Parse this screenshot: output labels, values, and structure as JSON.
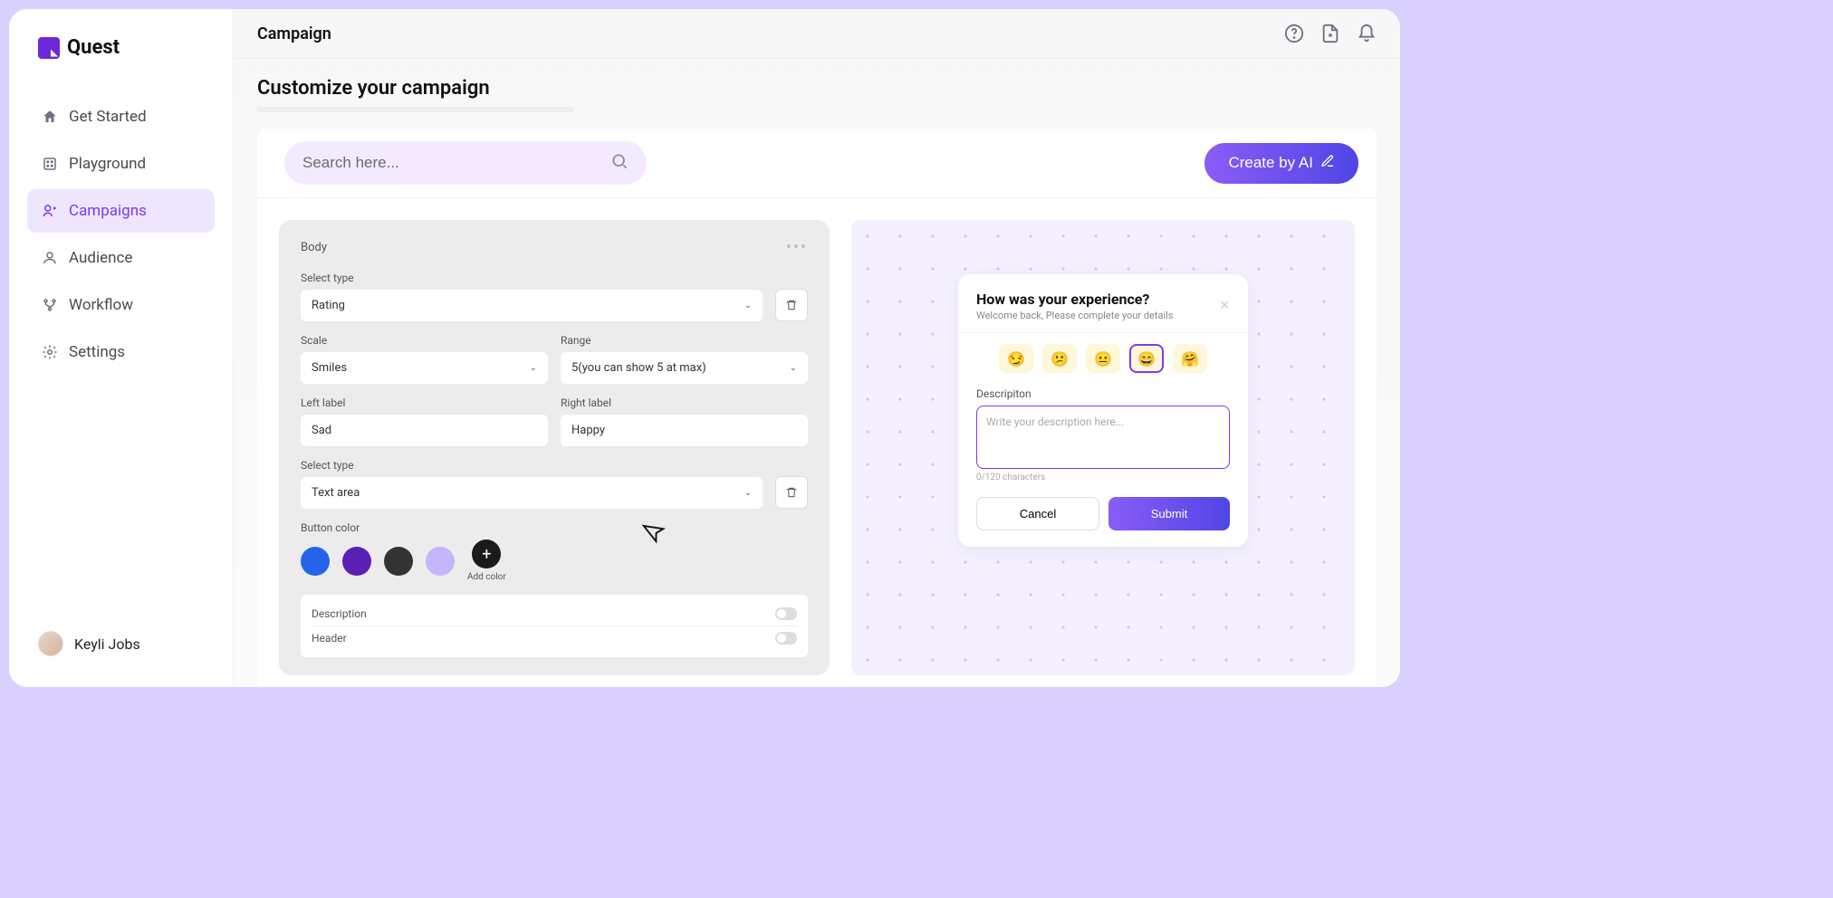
{
  "brand": "Quest",
  "user": {
    "name": "Keyli Jobs"
  },
  "sidebar": {
    "items": [
      {
        "label": "Get Started",
        "icon": "home"
      },
      {
        "label": "Playground",
        "icon": "grid"
      },
      {
        "label": "Campaigns",
        "icon": "user-plus"
      },
      {
        "label": "Audience",
        "icon": "user"
      },
      {
        "label": "Workflow",
        "icon": "branch"
      },
      {
        "label": "Settings",
        "icon": "gear"
      }
    ]
  },
  "header": {
    "title": "Campaign"
  },
  "page": {
    "title": "Customize your campaign",
    "search_placeholder": "Search here...",
    "create_label": "Create by AI"
  },
  "builder": {
    "section_title": "Body",
    "type1_label": "Select type",
    "type1_value": "Rating",
    "scale_label": "Scale",
    "scale_value": "Smiles",
    "range_label": "Range",
    "range_value": "5(you can show 5 at max)",
    "left_label": "Left label",
    "left_value": "Sad",
    "right_label": "Right label",
    "right_value": "Happy",
    "type2_label": "Select type",
    "type2_value": "Text area",
    "button_color_label": "Button color",
    "colors": [
      "#2563eb",
      "#5b21b6",
      "#333333",
      "#c4b5fd"
    ],
    "add_color_label": "Add color",
    "accordion": {
      "title": "Description",
      "item": "Header"
    }
  },
  "preview": {
    "title": "How was your experience?",
    "subtitle": "Welcome back, Please complete your details",
    "desc_label": "Descripiton",
    "textarea_placeholder": "Write your description here...",
    "char_count": "0/120 characters",
    "cancel": "Cancel",
    "submit": "Submit",
    "emojis": [
      "😏",
      "😕",
      "😐",
      "😄",
      "🤗"
    ]
  }
}
